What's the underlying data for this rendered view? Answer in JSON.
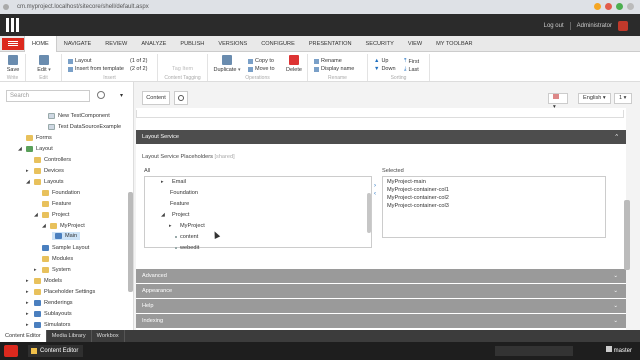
{
  "browser": {
    "url": "cm.myproject.localhost/sitecore/shell/default.aspx"
  },
  "topbar": {
    "logout": "Log out",
    "user": "Administrator"
  },
  "ribbon_tabs": [
    "HOME",
    "NAVIGATE",
    "REVIEW",
    "ANALYZE",
    "PUBLISH",
    "VERSIONS",
    "CONFIGURE",
    "PRESENTATION",
    "SECURITY",
    "VIEW",
    "MY TOOLBAR"
  ],
  "ribbon": {
    "save": "Save",
    "edit": "Edit",
    "write_cap": "Write",
    "edit_cap": "Edit",
    "layout": "Layout",
    "layout_count": "(1 of 2)",
    "insert_from_template": "Insert from template",
    "insert_count": "(2 of 2)",
    "insert_cap": "Insert",
    "tag_item": "Tag Item",
    "tagging_cap": "Content Tagging",
    "duplicate": "Duplicate",
    "copy_to": "Copy to",
    "move_to": "Move to",
    "delete": "Delete",
    "operations_cap": "Operations",
    "rename": "Rename",
    "display_name": "Display name",
    "rename_cap": "Rename",
    "up": "Up",
    "down": "Down",
    "first": "First",
    "last": "Last",
    "sorting_cap": "Sorting"
  },
  "left": {
    "search_placeholder": "Search",
    "tree": [
      {
        "label": "New TestComponent"
      },
      {
        "label": "Test DataSourceExample"
      },
      {
        "label": "Forms"
      },
      {
        "label": "Layout"
      },
      {
        "label": "Controllers"
      },
      {
        "label": "Devices"
      },
      {
        "label": "Layouts"
      },
      {
        "label": "Foundation"
      },
      {
        "label": "Feature"
      },
      {
        "label": "Project"
      },
      {
        "label": "MyProject"
      },
      {
        "label": "Main"
      },
      {
        "label": "Sample Layout"
      },
      {
        "label": "Modules"
      },
      {
        "label": "System"
      },
      {
        "label": "Models"
      },
      {
        "label": "Placeholder Settings"
      },
      {
        "label": "Renderings"
      },
      {
        "label": "Sublayouts"
      },
      {
        "label": "Simulators"
      }
    ]
  },
  "main": {
    "content_tab": "Content",
    "language": "English",
    "version": "1",
    "section_title": "Layout Service",
    "field_label": "Layout Service Placeholders",
    "field_hint": "[shared]",
    "all_label": "All",
    "selected_label": "Selected",
    "all_items": [
      "Email",
      "Foundation",
      "Feature",
      "Project",
      "MyProject",
      "content",
      "webedit"
    ],
    "selected_items": [
      "MyProject-main",
      "MyProject-container-col1",
      "MyProject-container-col2",
      "MyProject-container-col3"
    ],
    "collapsed_sections": [
      "Advanced",
      "Appearance",
      "Help",
      "Indexing"
    ]
  },
  "app_tabs": [
    "Content Editor",
    "Media Library",
    "Workbox"
  ],
  "taskbar": {
    "active_app": "Content Editor",
    "database": "master"
  }
}
